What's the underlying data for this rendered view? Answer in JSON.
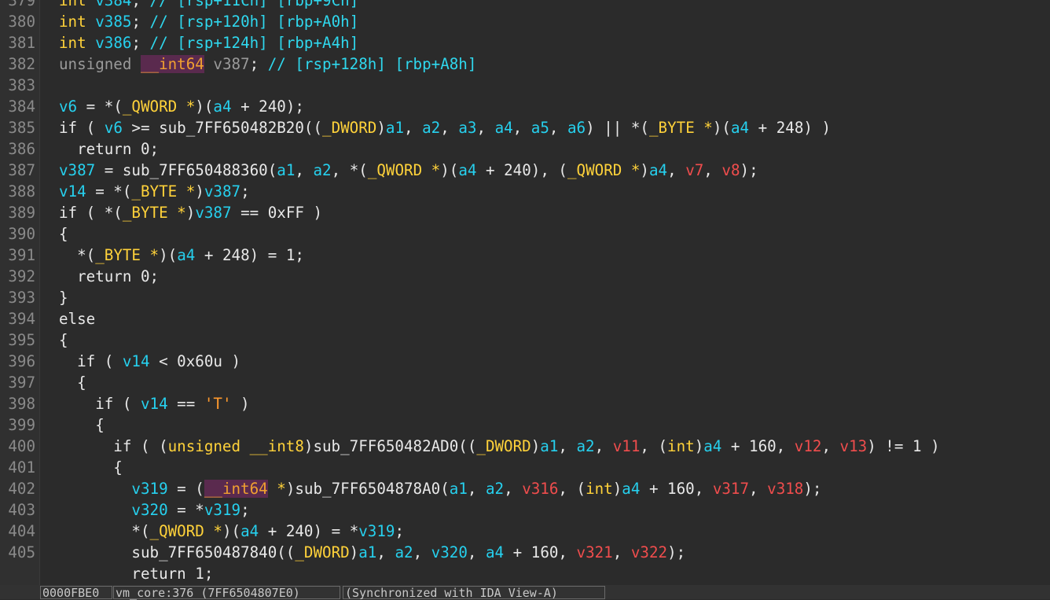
{
  "editor": {
    "lines": [
      {
        "num": "379",
        "tokens": [
          [
            "kwy",
            "int "
          ],
          [
            "var",
            "v384"
          ],
          [
            "op",
            "; "
          ],
          [
            "cm",
            "// [rsp+11Ch] [rbp+9Ch]"
          ]
        ]
      },
      {
        "num": "380",
        "tokens": [
          [
            "kwy",
            "int "
          ],
          [
            "var",
            "v385"
          ],
          [
            "op",
            "; "
          ],
          [
            "cm",
            "// [rsp+120h] [rbp+A0h]"
          ]
        ]
      },
      {
        "num": "381",
        "tokens": [
          [
            "kwy",
            "int "
          ],
          [
            "var",
            "v386"
          ],
          [
            "op",
            "; "
          ],
          [
            "cm",
            "// [rsp+124h] [rbp+A4h]"
          ]
        ]
      },
      {
        "num": "382",
        "tokens": [
          [
            "gray",
            "unsigned "
          ],
          [
            "hl",
            "__int64"
          ],
          [
            "gray",
            " v387"
          ],
          [
            "op",
            "; "
          ],
          [
            "cm",
            "// [rsp+128h] [rbp+A8h]"
          ]
        ]
      },
      {
        "num": "383",
        "tokens": []
      },
      {
        "num": "384",
        "tokens": [
          [
            "var",
            "v6"
          ],
          [
            "op",
            " = *("
          ],
          [
            "type",
            "_QWORD *"
          ],
          [
            "op",
            ")("
          ],
          [
            "var",
            "a4"
          ],
          [
            "op",
            " + 240);"
          ]
        ]
      },
      {
        "num": "385",
        "tokens": [
          [
            "kw",
            "if ( "
          ],
          [
            "var",
            "v6"
          ],
          [
            "op",
            " >= sub_7FF650482B20(("
          ],
          [
            "type",
            "_DWORD"
          ],
          [
            "op",
            ")"
          ],
          [
            "var",
            "a1"
          ],
          [
            "op",
            ", "
          ],
          [
            "var",
            "a2"
          ],
          [
            "op",
            ", "
          ],
          [
            "var",
            "a3"
          ],
          [
            "op",
            ", "
          ],
          [
            "var",
            "a4"
          ],
          [
            "op",
            ", "
          ],
          [
            "var",
            "a5"
          ],
          [
            "op",
            ", "
          ],
          [
            "var",
            "a6"
          ],
          [
            "op",
            ") || *("
          ],
          [
            "type",
            "_BYTE *"
          ],
          [
            "op",
            ")("
          ],
          [
            "var",
            "a4"
          ],
          [
            "op",
            " + 248) )"
          ]
        ]
      },
      {
        "num": "386",
        "tokens": [
          [
            "kw",
            "  return 0;"
          ]
        ]
      },
      {
        "num": "387",
        "tokens": [
          [
            "var",
            "v387"
          ],
          [
            "op",
            " = sub_7FF650488360("
          ],
          [
            "var",
            "a1"
          ],
          [
            "op",
            ", "
          ],
          [
            "var",
            "a2"
          ],
          [
            "op",
            ", *("
          ],
          [
            "type",
            "_QWORD *"
          ],
          [
            "op",
            ")("
          ],
          [
            "var",
            "a4"
          ],
          [
            "op",
            " + 240), ("
          ],
          [
            "type",
            "_QWORD *"
          ],
          [
            "op",
            ")"
          ],
          [
            "var",
            "a4"
          ],
          [
            "op",
            ", "
          ],
          [
            "red",
            "v7"
          ],
          [
            "op",
            ", "
          ],
          [
            "red",
            "v8"
          ],
          [
            "op",
            ");"
          ]
        ]
      },
      {
        "num": "388",
        "tokens": [
          [
            "var",
            "v14"
          ],
          [
            "op",
            " = *("
          ],
          [
            "type",
            "_BYTE *"
          ],
          [
            "op",
            ")"
          ],
          [
            "var",
            "v387"
          ],
          [
            "op",
            ";"
          ]
        ]
      },
      {
        "num": "389",
        "tokens": [
          [
            "kw",
            "if ( *("
          ],
          [
            "type",
            "_BYTE *"
          ],
          [
            "op",
            ")"
          ],
          [
            "var",
            "v387"
          ],
          [
            "op",
            " == 0xFF )"
          ]
        ]
      },
      {
        "num": "390",
        "tokens": [
          [
            "op",
            "{"
          ]
        ]
      },
      {
        "num": "391",
        "tokens": [
          [
            "op",
            "  *("
          ],
          [
            "type",
            "_BYTE *"
          ],
          [
            "op",
            ")("
          ],
          [
            "var",
            "a4"
          ],
          [
            "op",
            " + 248) = 1;"
          ]
        ]
      },
      {
        "num": "392",
        "tokens": [
          [
            "kw",
            "  return 0;"
          ]
        ]
      },
      {
        "num": "393",
        "tokens": [
          [
            "op",
            "}"
          ]
        ]
      },
      {
        "num": "394",
        "tokens": [
          [
            "kw",
            "else"
          ]
        ]
      },
      {
        "num": "395",
        "tokens": [
          [
            "op",
            "{"
          ]
        ]
      },
      {
        "num": "396",
        "tokens": [
          [
            "kw",
            "  if ( "
          ],
          [
            "var",
            "v14"
          ],
          [
            "op",
            " < 0x60u )"
          ]
        ]
      },
      {
        "num": "397",
        "tokens": [
          [
            "op",
            "  {"
          ]
        ]
      },
      {
        "num": "398",
        "tokens": [
          [
            "kw",
            "    if ( "
          ],
          [
            "var",
            "v14"
          ],
          [
            "op",
            " == "
          ],
          [
            "str",
            "'T'"
          ],
          [
            "op",
            " )"
          ]
        ]
      },
      {
        "num": "399",
        "tokens": [
          [
            "op",
            "    {"
          ]
        ]
      },
      {
        "num": "400",
        "tokens": [
          [
            "kw",
            "      if ( ("
          ],
          [
            "type",
            "unsigned __int8"
          ],
          [
            "op",
            ")sub_7FF650482AD0(("
          ],
          [
            "type",
            "_DWORD"
          ],
          [
            "op",
            ")"
          ],
          [
            "var",
            "a1"
          ],
          [
            "op",
            ", "
          ],
          [
            "var",
            "a2"
          ],
          [
            "op",
            ", "
          ],
          [
            "red",
            "v11"
          ],
          [
            "op",
            ", ("
          ],
          [
            "type",
            "int"
          ],
          [
            "op",
            ")"
          ],
          [
            "var",
            "a4"
          ],
          [
            "op",
            " + 160, "
          ],
          [
            "red",
            "v12"
          ],
          [
            "op",
            ", "
          ],
          [
            "red",
            "v13"
          ],
          [
            "op",
            ") != 1 )"
          ]
        ]
      },
      {
        "num": "401",
        "tokens": [
          [
            "op",
            "      {"
          ]
        ]
      },
      {
        "num": "402",
        "tokens": [
          [
            "var",
            "        v319"
          ],
          [
            "op",
            " = ("
          ],
          [
            "hl",
            "__int64"
          ],
          [
            "type",
            " *"
          ],
          [
            "op",
            ")sub_7FF6504878A0("
          ],
          [
            "var",
            "a1"
          ],
          [
            "op",
            ", "
          ],
          [
            "var",
            "a2"
          ],
          [
            "op",
            ", "
          ],
          [
            "red",
            "v316"
          ],
          [
            "op",
            ", ("
          ],
          [
            "type",
            "int"
          ],
          [
            "op",
            ")"
          ],
          [
            "var",
            "a4"
          ],
          [
            "op",
            " + 160, "
          ],
          [
            "red",
            "v317"
          ],
          [
            "op",
            ", "
          ],
          [
            "red",
            "v318"
          ],
          [
            "op",
            ");"
          ]
        ]
      },
      {
        "num": "403",
        "tokens": [
          [
            "var",
            "        v320"
          ],
          [
            "op",
            " = *"
          ],
          [
            "var",
            "v319"
          ],
          [
            "op",
            ";"
          ]
        ]
      },
      {
        "num": "404",
        "tokens": [
          [
            "op",
            "        *("
          ],
          [
            "type",
            "_QWORD *"
          ],
          [
            "op",
            ")("
          ],
          [
            "var",
            "a4"
          ],
          [
            "op",
            " + 240) = *"
          ],
          [
            "var",
            "v319"
          ],
          [
            "op",
            ";"
          ]
        ]
      },
      {
        "num": "405",
        "tokens": [
          [
            "op",
            "        sub_7FF650487840(("
          ],
          [
            "type",
            "_DWORD"
          ],
          [
            "op",
            ")"
          ],
          [
            "var",
            "a1"
          ],
          [
            "op",
            ", "
          ],
          [
            "var",
            "a2"
          ],
          [
            "op",
            ", "
          ],
          [
            "var",
            "v320"
          ],
          [
            "op",
            ", "
          ],
          [
            "var",
            "a4"
          ],
          [
            "op",
            " + 160, "
          ],
          [
            "red",
            "v321"
          ],
          [
            "op",
            ", "
          ],
          [
            "red",
            "v322"
          ],
          [
            "op",
            ");"
          ]
        ]
      },
      {
        "num": "",
        "tokens": [
          [
            "kw",
            "        return 1;"
          ]
        ]
      }
    ]
  },
  "statusbar": {
    "address": "0000FBE0",
    "location": "vm_core:376 (7FF6504807E0)",
    "sync": "(Synchronized with IDA View-A)"
  }
}
